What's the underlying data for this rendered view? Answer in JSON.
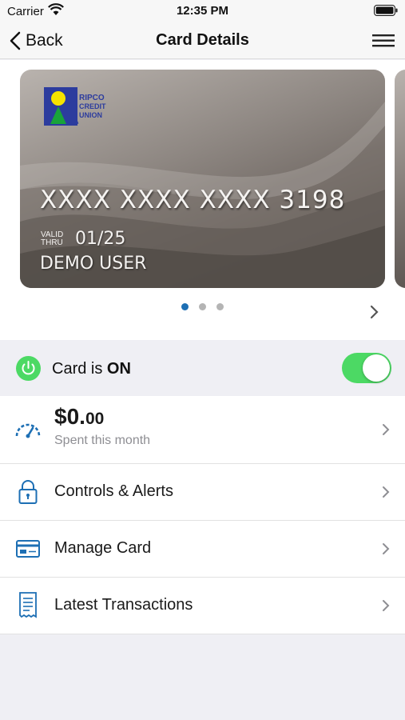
{
  "status_bar": {
    "carrier": "Carrier",
    "time": "12:35 PM"
  },
  "nav": {
    "back_label": "Back",
    "title": "Card Details"
  },
  "card": {
    "number": "XXXX XXXX XXXX 3198",
    "valid_label_1": "VALID",
    "valid_label_2": "THRU",
    "expiry": "01/25",
    "holder": "DEMO USER",
    "logo_text": [
      "RIPCO",
      "CREDIT",
      "UNION"
    ]
  },
  "carousel": {
    "page_count": 3,
    "active_index": 0
  },
  "card_status": {
    "prefix": "Card is ",
    "state": "ON",
    "toggle_on": true
  },
  "spending": {
    "dollars": "$0.",
    "cents": "00",
    "caption": "Spent this month"
  },
  "menu": [
    {
      "label": "Controls & Alerts",
      "icon": "lock-icon"
    },
    {
      "label": "Manage Card",
      "icon": "card-icon"
    },
    {
      "label": "Latest Transactions",
      "icon": "receipt-icon"
    }
  ],
  "colors": {
    "accent_blue": "#1d6fb4",
    "toggle_green": "#4cd964",
    "logo_blue": "#2c3c9e",
    "logo_yellow": "#f6e300",
    "logo_green": "#19a33a"
  }
}
